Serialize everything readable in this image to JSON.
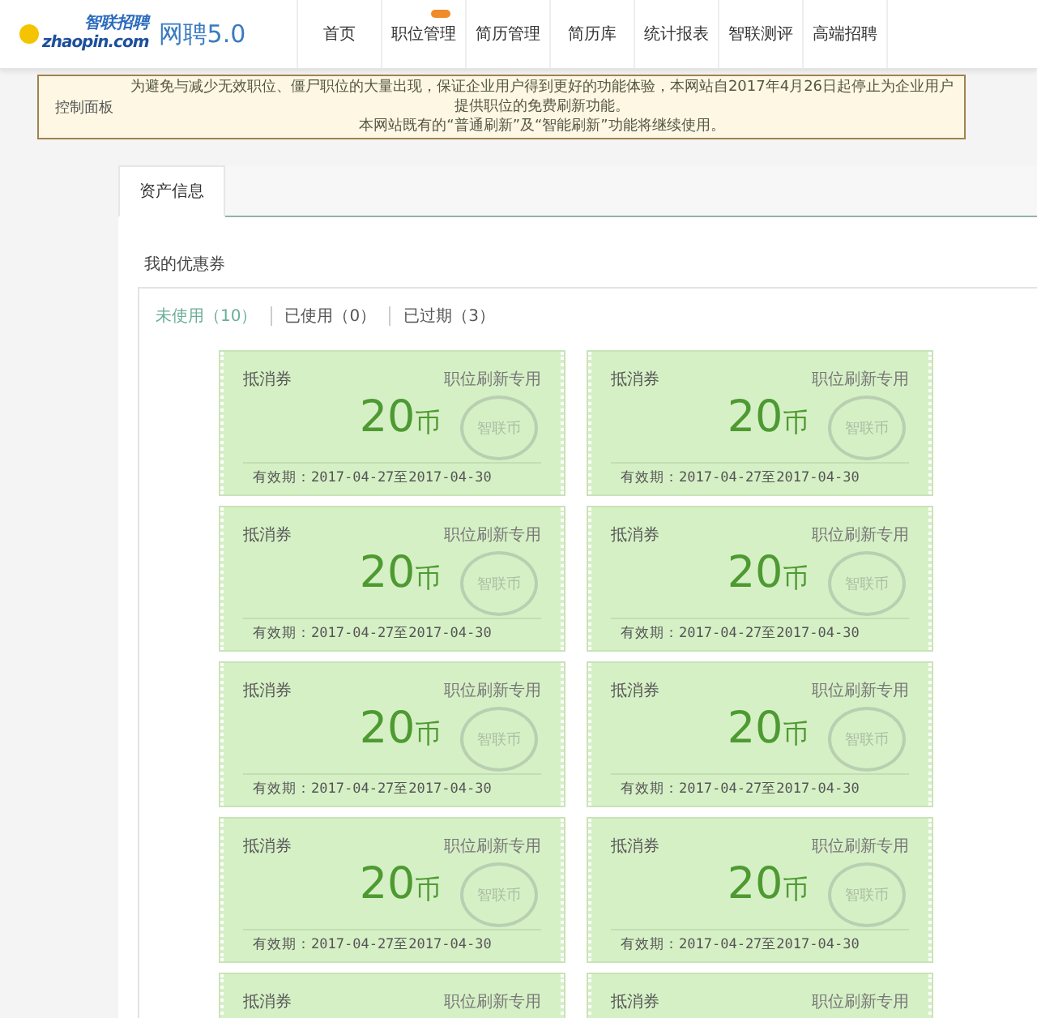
{
  "header": {
    "logo_cn": "智联招聘",
    "logo_en": "zhaopin.com",
    "product": "网聘5.0"
  },
  "nav": [
    {
      "label": "首页",
      "badge": false
    },
    {
      "label": "职位管理",
      "badge": true
    },
    {
      "label": "简历管理",
      "badge": false
    },
    {
      "label": "简历库",
      "badge": false
    },
    {
      "label": "统计报表",
      "badge": false
    },
    {
      "label": "智联测评",
      "badge": false
    },
    {
      "label": "高端招聘",
      "badge": false
    }
  ],
  "notice": {
    "label": "控制面板",
    "lines": [
      "为避免与减少无效职位、僵尸职位的大量出现，保证企业用户得到更好的功能体验，本网站自2017年4月26日起停止为企业用户提供职位的免费刷新功能。",
      "本网站既有的“普通刷新”及“智能刷新”功能将继续使用。"
    ]
  },
  "tabs": [
    {
      "label": "资产信息",
      "selected": true
    }
  ],
  "section_title": "我的优惠券",
  "filters": [
    {
      "label": "未使用（10）",
      "selected": true
    },
    {
      "label": "已使用（0）",
      "selected": false
    },
    {
      "label": "已过期（3）",
      "selected": false
    }
  ],
  "coupons": [
    {
      "label": "抵消券",
      "purpose": "职位刷新专用",
      "amount": "20",
      "unit": "币",
      "stamp": "智联币",
      "validity": "有效期：2017-04-27至2017-04-30"
    },
    {
      "label": "抵消券",
      "purpose": "职位刷新专用",
      "amount": "20",
      "unit": "币",
      "stamp": "智联币",
      "validity": "有效期：2017-04-27至2017-04-30"
    },
    {
      "label": "抵消券",
      "purpose": "职位刷新专用",
      "amount": "20",
      "unit": "币",
      "stamp": "智联币",
      "validity": "有效期：2017-04-27至2017-04-30"
    },
    {
      "label": "抵消券",
      "purpose": "职位刷新专用",
      "amount": "20",
      "unit": "币",
      "stamp": "智联币",
      "validity": "有效期：2017-04-27至2017-04-30"
    },
    {
      "label": "抵消券",
      "purpose": "职位刷新专用",
      "amount": "20",
      "unit": "币",
      "stamp": "智联币",
      "validity": "有效期：2017-04-27至2017-04-30"
    },
    {
      "label": "抵消券",
      "purpose": "职位刷新专用",
      "amount": "20",
      "unit": "币",
      "stamp": "智联币",
      "validity": "有效期：2017-04-27至2017-04-30"
    },
    {
      "label": "抵消券",
      "purpose": "职位刷新专用",
      "amount": "20",
      "unit": "币",
      "stamp": "智联币",
      "validity": "有效期：2017-04-27至2017-04-30"
    },
    {
      "label": "抵消券",
      "purpose": "职位刷新专用",
      "amount": "20",
      "unit": "币",
      "stamp": "智联币",
      "validity": "有效期：2017-04-27至2017-04-30"
    },
    {
      "label": "抵消券",
      "purpose": "职位刷新专用"
    },
    {
      "label": "抵消券",
      "purpose": "职位刷新专用"
    }
  ]
}
